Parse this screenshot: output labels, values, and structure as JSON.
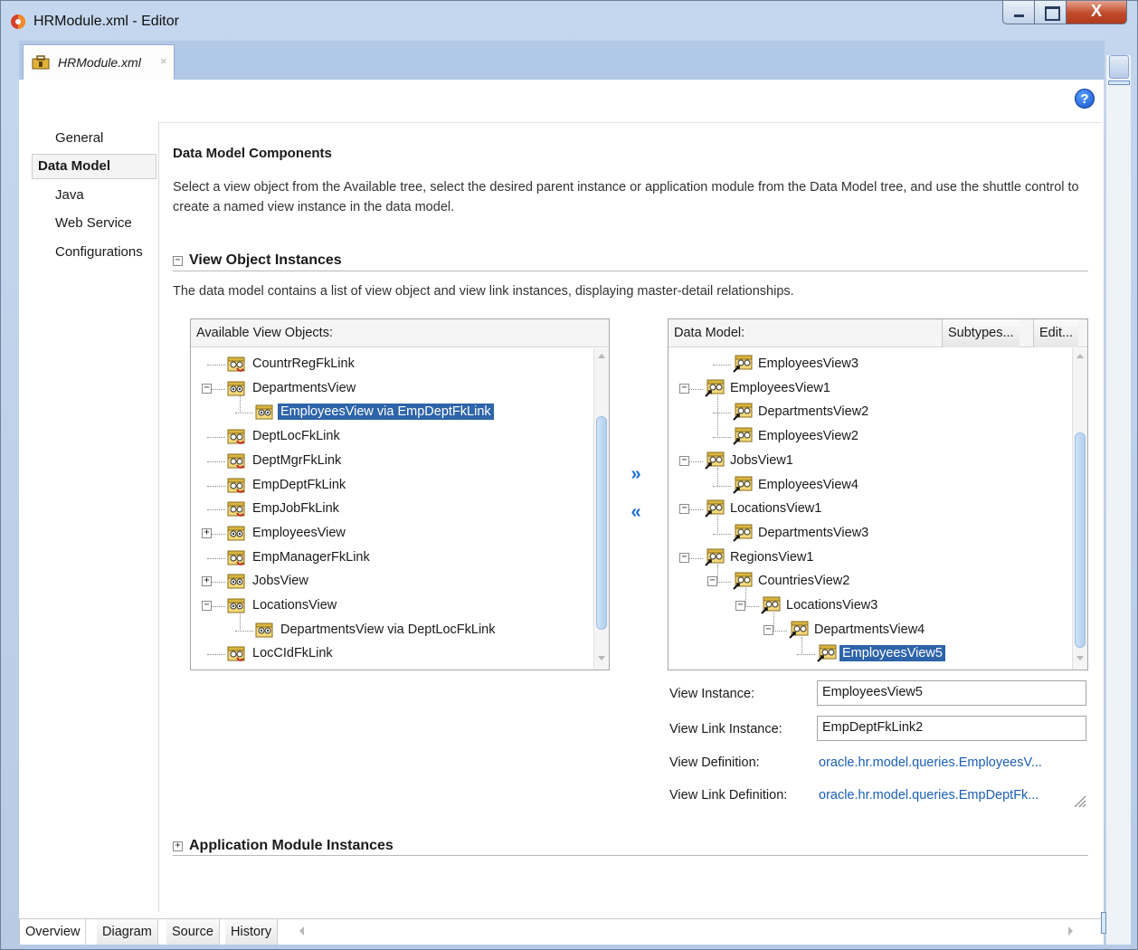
{
  "window": {
    "title": "HRModule.xml - Editor"
  },
  "doc_tab": {
    "label": "HRModule.xml",
    "close": "×"
  },
  "nav": {
    "items": [
      "General",
      "Data Model",
      "Java",
      "Web Service",
      "Configurations"
    ],
    "selected": "Data Model"
  },
  "components": {
    "heading": "Data Model Components",
    "description": "Select a view object from the Available tree, select the desired parent instance or application module from the Data Model tree, and use the shuttle control to create a named view instance in the data model."
  },
  "vo_section": {
    "toggle": "−",
    "title": "View Object Instances",
    "description": "The data model contains a list of view object and view link instances, displaying master-detail relationships."
  },
  "available": {
    "header": "Available View Objects:",
    "rows": [
      {
        "label": "CountrRegFkLink",
        "kind": "link"
      },
      {
        "label": "DepartmentsView",
        "kind": "view"
      },
      {
        "label": "EmployeesView via EmpDeptFkLink",
        "kind": "view"
      },
      {
        "label": "DeptLocFkLink",
        "kind": "link"
      },
      {
        "label": "DeptMgrFkLink",
        "kind": "link"
      },
      {
        "label": "EmpDeptFkLink",
        "kind": "link"
      },
      {
        "label": "EmpJobFkLink",
        "kind": "link"
      },
      {
        "label": "EmployeesView",
        "kind": "view"
      },
      {
        "label": "EmpManagerFkLink",
        "kind": "link"
      },
      {
        "label": "JobsView",
        "kind": "view"
      },
      {
        "label": "LocationsView",
        "kind": "view"
      },
      {
        "label": "DepartmentsView via DeptLocFkLink",
        "kind": "view"
      },
      {
        "label": "LocCIdFkLink",
        "kind": "link"
      }
    ]
  },
  "shuttle": {
    "add": "»",
    "remove": "«"
  },
  "data_model": {
    "header": "Data Model:",
    "subtypes_button": "Subtypes...",
    "edit_button": "Edit...",
    "rows": [
      {
        "label": "EmployeesView3"
      },
      {
        "label": "EmployeesView1"
      },
      {
        "label": "DepartmentsView2"
      },
      {
        "label": "EmployeesView2"
      },
      {
        "label": "JobsView1"
      },
      {
        "label": "EmployeesView4"
      },
      {
        "label": "LocationsView1"
      },
      {
        "label": "DepartmentsView3"
      },
      {
        "label": "RegionsView1"
      },
      {
        "label": "CountriesView2"
      },
      {
        "label": "LocationsView3"
      },
      {
        "label": "DepartmentsView4"
      },
      {
        "label": "EmployeesView5"
      }
    ]
  },
  "properties": {
    "view_instance_label": "View Instance:",
    "view_instance_value": "EmployeesView5",
    "view_link_instance_label": "View Link Instance:",
    "view_link_instance_value": "EmpDeptFkLink2",
    "view_definition_label": "View Definition:",
    "view_definition_value": "oracle.hr.model.queries.EmployeesV...",
    "view_link_definition_label": "View Link Definition:",
    "view_link_definition_value": "oracle.hr.model.queries.EmpDeptFk..."
  },
  "am_section": {
    "toggle": "+",
    "title": "Application Module Instances"
  },
  "bottom_tabs": [
    "Overview",
    "Diagram",
    "Source",
    "History"
  ],
  "colors": {
    "selection": "#2e64a9",
    "link": "#1a5fb4",
    "shuttle": "#1e6fd0",
    "help": "#1553c9"
  },
  "icons": {
    "app": "oracle-jdev-icon",
    "tab": "application-module-icon",
    "help": "help-icon",
    "vo": "view-object-icon",
    "vl": "view-link-icon"
  }
}
